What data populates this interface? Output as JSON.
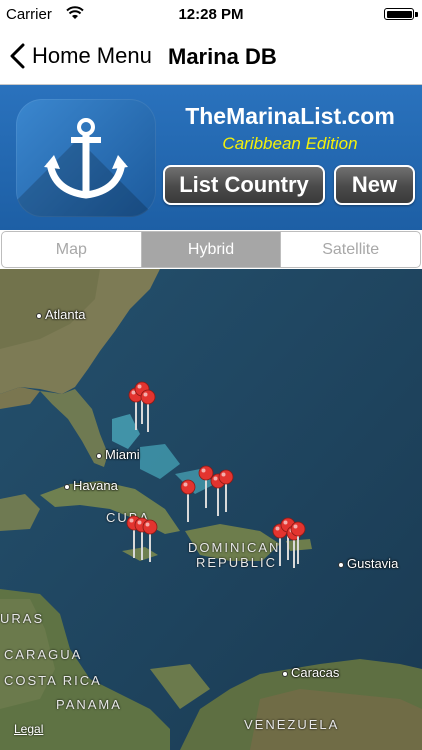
{
  "status_bar": {
    "carrier": "Carrier",
    "time": "12:28 PM"
  },
  "nav": {
    "back_label": "Home Menu",
    "title": "Marina DB"
  },
  "banner": {
    "brand": "TheMarinaList.com",
    "edition": "Caribbean Edition",
    "list_country_label": "List Country",
    "new_label": "New",
    "edition_color": "#f4f10a",
    "background_color": "#1f64ab"
  },
  "segment": {
    "options": [
      "Map",
      "Hybrid",
      "Satellite"
    ],
    "selected": "Hybrid"
  },
  "map": {
    "cities": [
      "Atlanta",
      "Miami",
      "Havana",
      "Gustavia",
      "Caracas"
    ],
    "regions": [
      "CUBA",
      "DOMINICAN",
      "REPUBLIC",
      "URAS",
      "CARAGUA",
      "COSTA RICA",
      "PANAMA",
      "VENEZUELA"
    ],
    "legal_label": "Legal",
    "pin_color": "#e3342f",
    "pin_count": 14
  }
}
